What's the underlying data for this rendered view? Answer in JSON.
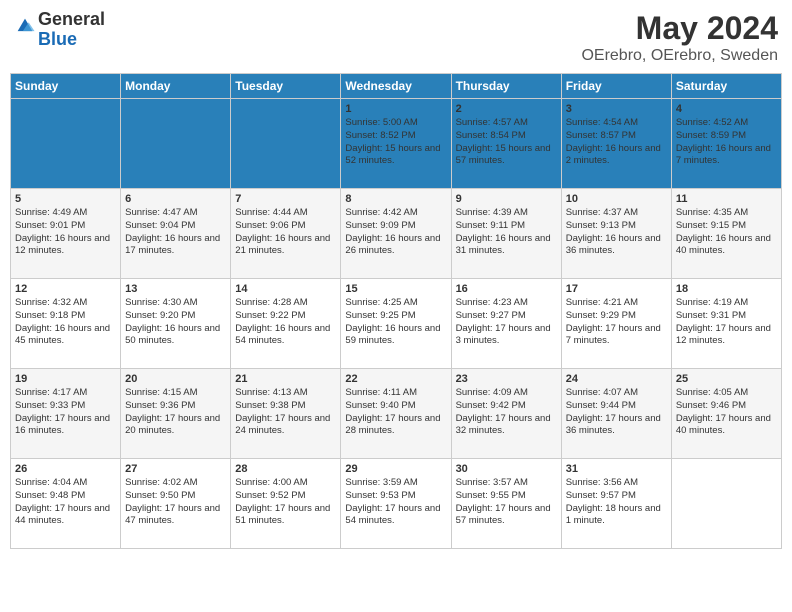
{
  "header": {
    "logo_general": "General",
    "logo_blue": "Blue",
    "title": "May 2024",
    "subtitle": "OErebro, OErebro, Sweden"
  },
  "days": [
    "Sunday",
    "Monday",
    "Tuesday",
    "Wednesday",
    "Thursday",
    "Friday",
    "Saturday"
  ],
  "weeks": [
    [
      {
        "date": "",
        "info": ""
      },
      {
        "date": "",
        "info": ""
      },
      {
        "date": "",
        "info": ""
      },
      {
        "date": "1",
        "info": "Sunrise: 5:00 AM\nSunset: 8:52 PM\nDaylight: 15 hours and 52 minutes."
      },
      {
        "date": "2",
        "info": "Sunrise: 4:57 AM\nSunset: 8:54 PM\nDaylight: 15 hours and 57 minutes."
      },
      {
        "date": "3",
        "info": "Sunrise: 4:54 AM\nSunset: 8:57 PM\nDaylight: 16 hours and 2 minutes."
      },
      {
        "date": "4",
        "info": "Sunrise: 4:52 AM\nSunset: 8:59 PM\nDaylight: 16 hours and 7 minutes."
      }
    ],
    [
      {
        "date": "5",
        "info": "Sunrise: 4:49 AM\nSunset: 9:01 PM\nDaylight: 16 hours and 12 minutes."
      },
      {
        "date": "6",
        "info": "Sunrise: 4:47 AM\nSunset: 9:04 PM\nDaylight: 16 hours and 17 minutes."
      },
      {
        "date": "7",
        "info": "Sunrise: 4:44 AM\nSunset: 9:06 PM\nDaylight: 16 hours and 21 minutes."
      },
      {
        "date": "8",
        "info": "Sunrise: 4:42 AM\nSunset: 9:09 PM\nDaylight: 16 hours and 26 minutes."
      },
      {
        "date": "9",
        "info": "Sunrise: 4:39 AM\nSunset: 9:11 PM\nDaylight: 16 hours and 31 minutes."
      },
      {
        "date": "10",
        "info": "Sunrise: 4:37 AM\nSunset: 9:13 PM\nDaylight: 16 hours and 36 minutes."
      },
      {
        "date": "11",
        "info": "Sunrise: 4:35 AM\nSunset: 9:15 PM\nDaylight: 16 hours and 40 minutes."
      }
    ],
    [
      {
        "date": "12",
        "info": "Sunrise: 4:32 AM\nSunset: 9:18 PM\nDaylight: 16 hours and 45 minutes."
      },
      {
        "date": "13",
        "info": "Sunrise: 4:30 AM\nSunset: 9:20 PM\nDaylight: 16 hours and 50 minutes."
      },
      {
        "date": "14",
        "info": "Sunrise: 4:28 AM\nSunset: 9:22 PM\nDaylight: 16 hours and 54 minutes."
      },
      {
        "date": "15",
        "info": "Sunrise: 4:25 AM\nSunset: 9:25 PM\nDaylight: 16 hours and 59 minutes."
      },
      {
        "date": "16",
        "info": "Sunrise: 4:23 AM\nSunset: 9:27 PM\nDaylight: 17 hours and 3 minutes."
      },
      {
        "date": "17",
        "info": "Sunrise: 4:21 AM\nSunset: 9:29 PM\nDaylight: 17 hours and 7 minutes."
      },
      {
        "date": "18",
        "info": "Sunrise: 4:19 AM\nSunset: 9:31 PM\nDaylight: 17 hours and 12 minutes."
      }
    ],
    [
      {
        "date": "19",
        "info": "Sunrise: 4:17 AM\nSunset: 9:33 PM\nDaylight: 17 hours and 16 minutes."
      },
      {
        "date": "20",
        "info": "Sunrise: 4:15 AM\nSunset: 9:36 PM\nDaylight: 17 hours and 20 minutes."
      },
      {
        "date": "21",
        "info": "Sunrise: 4:13 AM\nSunset: 9:38 PM\nDaylight: 17 hours and 24 minutes."
      },
      {
        "date": "22",
        "info": "Sunrise: 4:11 AM\nSunset: 9:40 PM\nDaylight: 17 hours and 28 minutes."
      },
      {
        "date": "23",
        "info": "Sunrise: 4:09 AM\nSunset: 9:42 PM\nDaylight: 17 hours and 32 minutes."
      },
      {
        "date": "24",
        "info": "Sunrise: 4:07 AM\nSunset: 9:44 PM\nDaylight: 17 hours and 36 minutes."
      },
      {
        "date": "25",
        "info": "Sunrise: 4:05 AM\nSunset: 9:46 PM\nDaylight: 17 hours and 40 minutes."
      }
    ],
    [
      {
        "date": "26",
        "info": "Sunrise: 4:04 AM\nSunset: 9:48 PM\nDaylight: 17 hours and 44 minutes."
      },
      {
        "date": "27",
        "info": "Sunrise: 4:02 AM\nSunset: 9:50 PM\nDaylight: 17 hours and 47 minutes."
      },
      {
        "date": "28",
        "info": "Sunrise: 4:00 AM\nSunset: 9:52 PM\nDaylight: 17 hours and 51 minutes."
      },
      {
        "date": "29",
        "info": "Sunrise: 3:59 AM\nSunset: 9:53 PM\nDaylight: 17 hours and 54 minutes."
      },
      {
        "date": "30",
        "info": "Sunrise: 3:57 AM\nSunset: 9:55 PM\nDaylight: 17 hours and 57 minutes."
      },
      {
        "date": "31",
        "info": "Sunrise: 3:56 AM\nSunset: 9:57 PM\nDaylight: 18 hours and 1 minute."
      },
      {
        "date": "",
        "info": ""
      }
    ]
  ]
}
